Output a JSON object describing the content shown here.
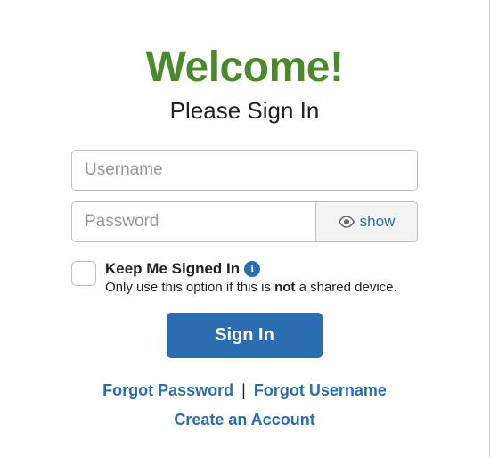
{
  "header": {
    "title": "Welcome!",
    "subtitle": "Please Sign In"
  },
  "inputs": {
    "username_placeholder": "Username",
    "password_placeholder": "Password",
    "show_label": "show"
  },
  "keep_signed": {
    "label": "Keep Me Signed In",
    "hint_prefix": "Only use this option if this is ",
    "hint_bold": "not",
    "hint_suffix": " a shared device."
  },
  "actions": {
    "signin": "Sign In",
    "forgot_password": "Forgot Password",
    "forgot_username": "Forgot Username",
    "create_account": "Create an Account",
    "divider": "|"
  }
}
